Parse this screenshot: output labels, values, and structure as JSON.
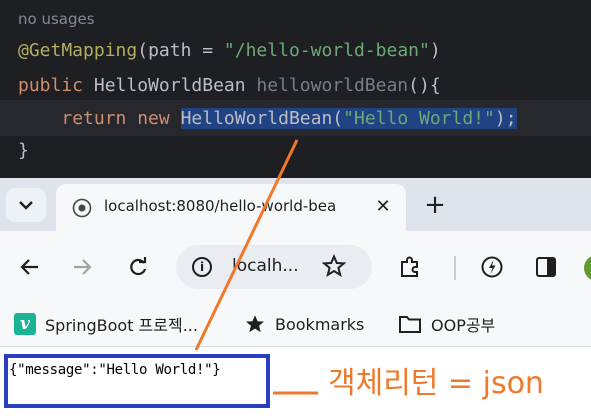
{
  "ide": {
    "hint": "no usages",
    "line1": {
      "annotation": "@GetMapping",
      "open": "(",
      "param": "path = ",
      "string": "\"/hello-world-bean\"",
      "close": ")"
    },
    "line2": {
      "keyword": "public",
      "type": " HelloWorldBean ",
      "method": "helloworldBean",
      "tail": "(){"
    },
    "line3": {
      "keyword": "return new ",
      "selected_class": "HelloWorldBean",
      "selected_open": "(",
      "selected_string": "\"Hello World!\"",
      "selected_close": ");"
    },
    "line4": "}"
  },
  "browser": {
    "tab_title": "localhost:8080/hello-world-bea",
    "tab_close": "✕",
    "new_tab": "+",
    "url": "localh...",
    "bookmarks": [
      {
        "label": "SpringBoot 프로젝...",
        "icon": "v-logo-icon"
      },
      {
        "label": "Bookmarks",
        "icon": "star-icon"
      },
      {
        "label": "OOP공부",
        "icon": "folder-icon"
      }
    ],
    "page_json": "{\"message\":\"Hello World!\"}"
  },
  "annotation": {
    "note": "객체리턴 = json",
    "color": "#f0782a",
    "box_color": "#2a3fbf"
  }
}
